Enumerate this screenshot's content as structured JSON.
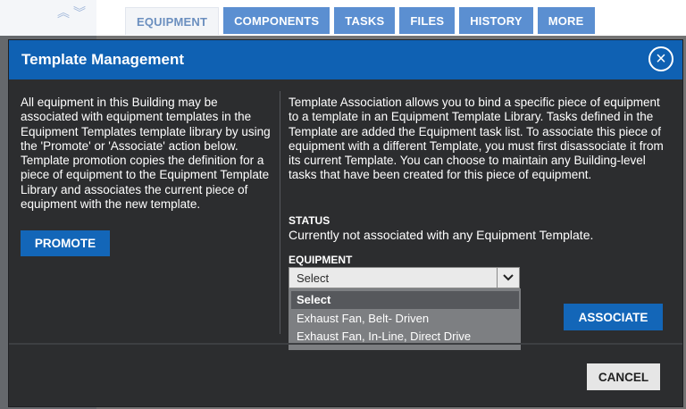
{
  "tabs": [
    {
      "label": "EQUIPMENT",
      "active": true
    },
    {
      "label": "COMPONENTS",
      "active": false
    },
    {
      "label": "TASKS",
      "active": false
    },
    {
      "label": "FILES",
      "active": false
    },
    {
      "label": "HISTORY",
      "active": false
    },
    {
      "label": "MORE",
      "active": false
    }
  ],
  "modal": {
    "title": "Template Management",
    "close_icon": "×",
    "left_description": "All equipment in this Building may be associated with equipment templates in the Equipment Templates template library by using the 'Promote' or 'Associate' action below. Template promotion copies the definition for a piece of equipment to the Equipment Template Library and associates the current piece of equipment with the new template.",
    "promote_label": "PROMOTE",
    "right_description": "Template Association allows you to bind a specific piece of equipment to a template in an Equipment Template Library. Tasks defined in the Template are added the Equipment task list. To associate this piece of equipment with a different Template, you must first disassociate it from its current Template. You can choose to maintain any Building-level tasks that have been created for this piece of equipment.",
    "status_label": "STATUS",
    "status_value": "Currently not associated with any Equipment Template.",
    "equipment_label": "EQUIPMENT",
    "select_value": "Select",
    "options": [
      "Select",
      "Exhaust Fan, Belt- Driven",
      "Exhaust Fan, In-Line, Direct Drive"
    ],
    "associate_label": "ASSOCIATE",
    "cancel_label": "CANCEL"
  },
  "colors": {
    "header_blue": "#0f61b3",
    "button_blue": "#1366b8",
    "tab_blue": "#5b8fd1",
    "modal_bg": "#2c2d2f"
  }
}
